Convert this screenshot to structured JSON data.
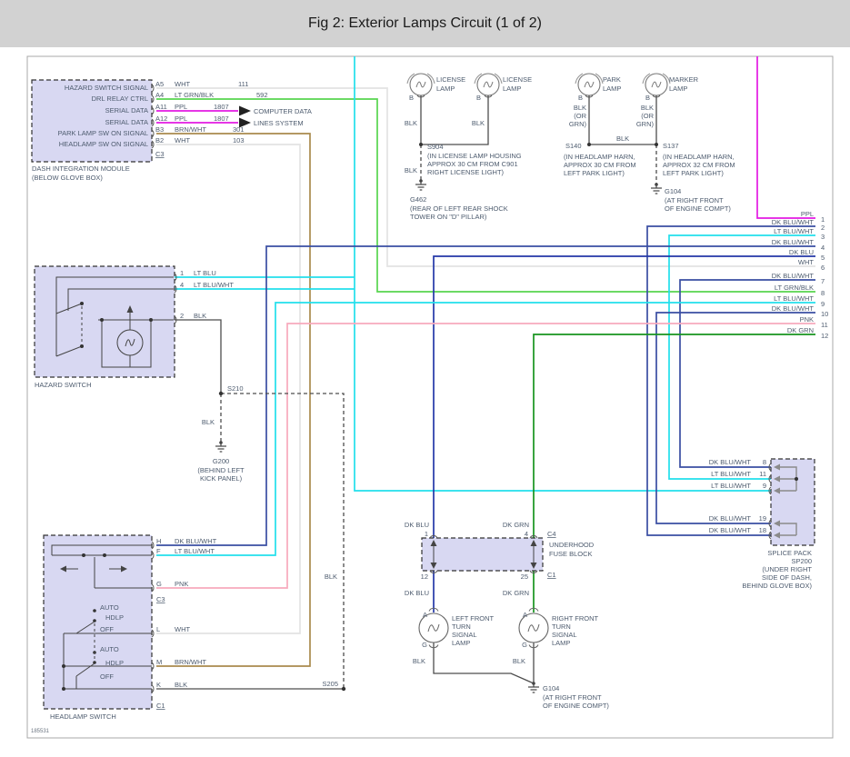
{
  "title": "Fig 2: Exterior Lamps Circuit (1 of 2)",
  "sheet_number": "185531",
  "colors": {
    "ppl": "#e31ae3",
    "dk_blu_wht": "#3a4ea3",
    "dk_blu": "#2438a8",
    "lt_blu": "#22dfec",
    "wht": "#e3e3e3",
    "lt_grn_blk": "#57d54f",
    "brn_wht": "#a98a4d",
    "pnk": "#f8a9bd",
    "dk_grn": "#17941f",
    "blk": "#4d4d4d"
  },
  "dim_module": {
    "label": "DASH INTEGRATION MODULE",
    "sublabel": "(BELOW GLOVE BOX)",
    "connector": "C3",
    "pins": [
      {
        "signal": "HAZARD SWITCH SIGNAL",
        "id": "A5",
        "color": "WHT",
        "circuit": "111"
      },
      {
        "signal": "DRL RELAY CTRL",
        "id": "A4",
        "color": "LT GRN/BLK",
        "circuit": "592"
      },
      {
        "signal": "SERIAL DATA",
        "id": "A11",
        "color": "PPL",
        "circuit": "1807"
      },
      {
        "signal": "SERIAL DATA",
        "id": "A12",
        "color": "PPL",
        "circuit": "1807"
      },
      {
        "signal": "PARK LAMP SW ON SIGNAL",
        "id": "B3",
        "color": "BRN/WHT",
        "circuit": "301"
      },
      {
        "signal": "HEADLAMP SW ON SIGNAL",
        "id": "B2",
        "color": "WHT",
        "circuit": "103"
      }
    ],
    "bus_note1": "COMPUTER DATA",
    "bus_note2": "LINES SYSTEM"
  },
  "license_lamps": {
    "name1": "LICENSE",
    "name2": "LAMP",
    "pin": "B",
    "wire": "BLK",
    "splice": "S904",
    "splice_desc1": "(IN LICENSE LAMP HOUSING",
    "splice_desc2": "APPROX 30 CM FROM C901",
    "splice_desc3": "RIGHT LICENSE LIGHT)",
    "gnd_wire": "BLK",
    "ground": "G462",
    "ground_desc1": "(REAR OF LEFT REAR SHOCK",
    "ground_desc2": "TOWER ON \"D\" PILLAR)"
  },
  "park_lamp": {
    "name1": "PARK",
    "name2": "LAMP",
    "pin": "B",
    "wire1": "BLK",
    "wire2": "(OR",
    "wire3": "GRN)",
    "splice": "S140",
    "desc1": "(IN HEADLAMP HARN,",
    "desc2": "APPROX 30 CM FROM",
    "desc3": "LEFT PARK LIGHT)"
  },
  "marker_lamp": {
    "name1": "MARKER",
    "name2": "LAMP",
    "pin": "B",
    "wire1": "BLK",
    "wire2": "(OR",
    "wire3": "GRN)",
    "splice": "S137",
    "desc1": "(IN HEADLAMP HARN,",
    "desc2": "APPROX 32 CM FROM",
    "desc3": "LEFT PARK LIGHT)",
    "link_wire": "BLK",
    "ground": "G104",
    "ground_desc1": "(AT RIGHT FRONT",
    "ground_desc2": "OF ENGINE COMPT)"
  },
  "edge_wires": [
    {
      "num": "1",
      "label": "PPL"
    },
    {
      "num": "2",
      "label": "DK BLU/WHT"
    },
    {
      "num": "3",
      "label": "LT BLU/WHT"
    },
    {
      "num": "4",
      "label": "DK BLU/WHT"
    },
    {
      "num": "5",
      "label": "DK BLU"
    },
    {
      "num": "6",
      "label": "WHT"
    },
    {
      "num": "7",
      "label": "DK BLU/WHT"
    },
    {
      "num": "8",
      "label": "LT GRN/BLK"
    },
    {
      "num": "9",
      "label": "LT BLU/WHT"
    },
    {
      "num": "10",
      "label": "DK BLU/WHT"
    },
    {
      "num": "11",
      "label": "PNK"
    },
    {
      "num": "12",
      "label": "DK GRN"
    }
  ],
  "hazard_switch": {
    "label": "HAZARD SWITCH",
    "pins": [
      {
        "id": "1",
        "color": "LT BLU"
      },
      {
        "id": "4",
        "color": "LT BLU/WHT"
      },
      {
        "id": "2",
        "color": "BLK"
      }
    ],
    "splice": "S210",
    "gnd_wire": "BLK",
    "ground": "G200",
    "ground_desc1": "(BEHIND LEFT",
    "ground_desc2": "KICK PANEL)"
  },
  "s205": {
    "label": "S205",
    "wire": "BLK"
  },
  "headlamp_switch": {
    "label": "HEADLAMP SWITCH",
    "connector_mid": "C3",
    "connector_bottom": "C1",
    "pos_auto": "AUTO",
    "pos_hdlp": "HDLP",
    "pos_off": "OFF",
    "pins": [
      {
        "id": "H",
        "color": "DK BLU/WHT"
      },
      {
        "id": "F",
        "color": "LT BLU/WHT"
      },
      {
        "id": "G",
        "color": "PNK"
      },
      {
        "id": "L",
        "color": "WHT"
      },
      {
        "id": "M",
        "color": "BRN/WHT"
      },
      {
        "id": "K",
        "color": "BLK"
      }
    ]
  },
  "fuse_block": {
    "name1": "UNDERHOOD",
    "name2": "FUSE BLOCK",
    "c_top": "C4",
    "c_bottom": "C1",
    "pin_tl": "1",
    "pin_tr": "4",
    "pin_bl": "12",
    "pin_br": "25",
    "wire_tl": "DK BLU",
    "wire_tr": "DK GRN",
    "wire_bl": "DK BLU",
    "wire_br": "DK GRN"
  },
  "turn_lamp_left": {
    "pin_a": "A",
    "pin_g": "G",
    "wire": "BLK",
    "name1": "LEFT FRONT",
    "name2": "TURN",
    "name3": "SIGNAL",
    "name4": "LAMP"
  },
  "turn_lamp_right": {
    "pin_a": "A",
    "pin_g": "G",
    "wire": "BLK",
    "name1": "RIGHT FRONT",
    "name2": "TURN",
    "name3": "SIGNAL",
    "name4": "LAMP"
  },
  "front_ground": {
    "id": "G104",
    "desc1": "(AT RIGHT FRONT",
    "desc2": "OF ENGINE COMPT)"
  },
  "splice_pack": {
    "label1": "SPLICE PACK",
    "label2": "SP200",
    "label3": "(UNDER RIGHT",
    "label4": "SIDE OF DASH,",
    "label5": "BEHIND GLOVE BOX)",
    "pins": [
      {
        "color": "DK BLU/WHT",
        "num": "8"
      },
      {
        "color": "LT BLU/WHT",
        "num": "11"
      },
      {
        "color": "LT BLU/WHT",
        "num": "9"
      },
      {
        "color": "DK BLU/WHT",
        "num": "19"
      },
      {
        "color": "DK BLU/WHT",
        "num": "18"
      }
    ]
  }
}
